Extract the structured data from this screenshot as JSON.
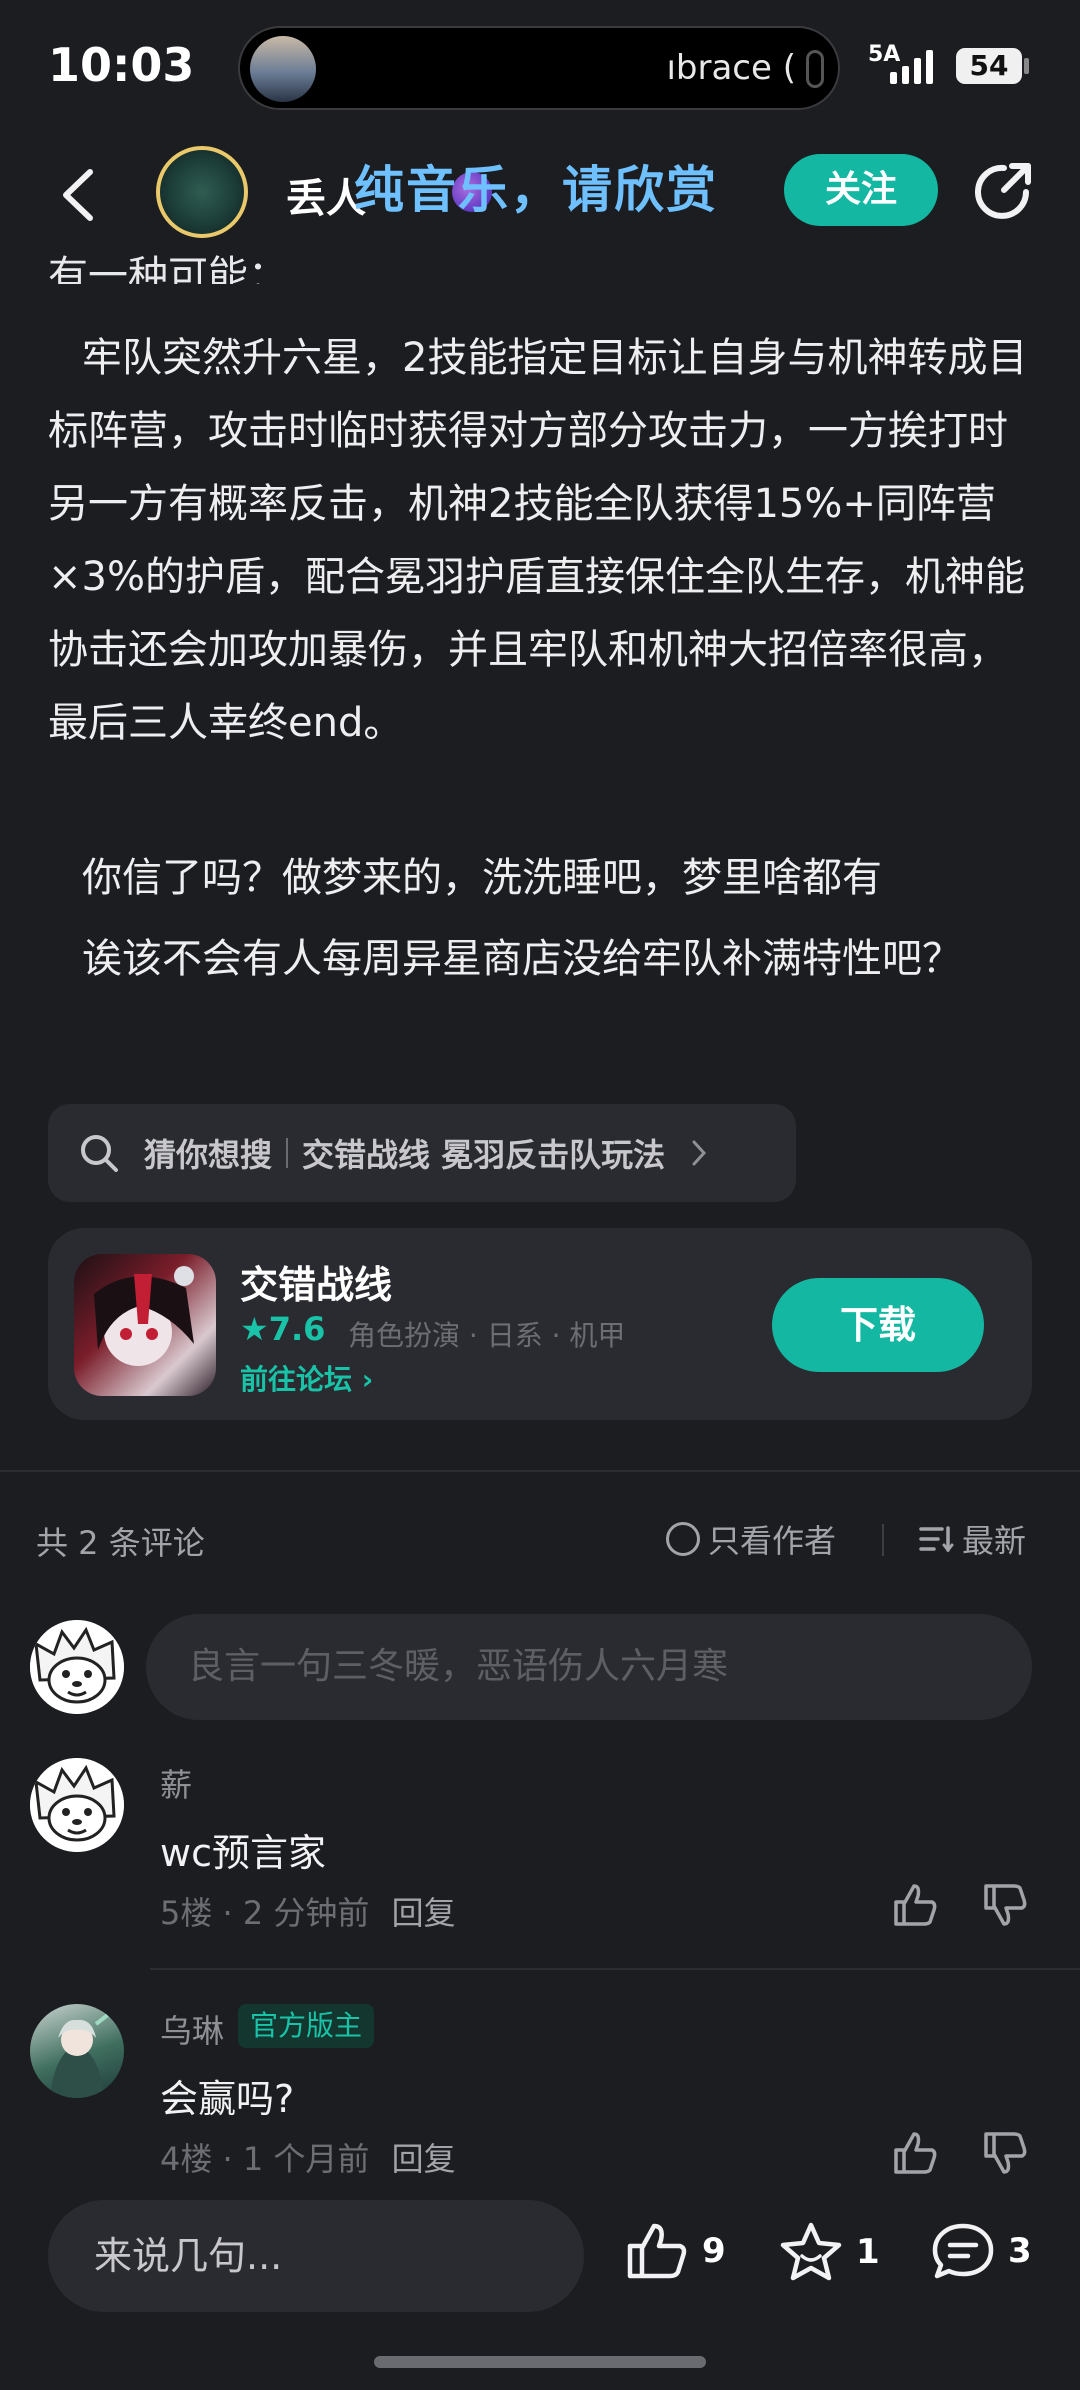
{
  "status_bar": {
    "time": "10:03",
    "media_text": "ıbrace (",
    "network": "5A",
    "battery": "54"
  },
  "header": {
    "author_name": "丢人",
    "music_overlay": "纯音乐，请欣赏",
    "follow_label": "关注"
  },
  "article": {
    "cut_line": "有一种可能：",
    "paragraphs": [
      "牢队突然升六星，2技能指定目标让自身与机神转成目标阵营，攻击时临时获得对方部分攻击力，一方挨打时另一方有概率反击，机神2技能全队获得15%+同阵营×3%的护盾，配合冕羽护盾直接保住全队生存，机神能协击还会加攻加暴伤，并且牢队和机神大招倍率很高，最后三人幸终end。",
      "你信了吗？做梦来的，洗洗睡吧，梦里啥都有",
      "诶该不会有人每周异星商店没给牢队补满特性吧？"
    ]
  },
  "search_suggest": {
    "label": "猜你想搜",
    "query": "交错战线 冕羽反击队玩法"
  },
  "game_card": {
    "title": "交错战线",
    "rating": "7.6",
    "tags": "角色扮演 · 日系 · 机甲",
    "forum_link": "前往论坛",
    "download_label": "下载",
    "accent": "#14b8a2"
  },
  "comments_header": {
    "count": "共 2 条评论",
    "only_author": "只看作者",
    "sort": "最新"
  },
  "comment_input": {
    "placeholder": "良言一句三冬暖，恶语伤人六月寒"
  },
  "comments": [
    {
      "name": "薪",
      "text": "wc预言家",
      "floor": "5楼",
      "time": "2 分钟前",
      "reply": "回复",
      "badge": ""
    },
    {
      "name": "乌琳",
      "text": "会赢吗?",
      "floor": "4楼",
      "time": "1 个月前",
      "reply": "回复",
      "badge": "官方版主"
    }
  ],
  "bottom_bar": {
    "placeholder": "来说几句...",
    "likes": "9",
    "favorites": "1",
    "comments": "3"
  }
}
